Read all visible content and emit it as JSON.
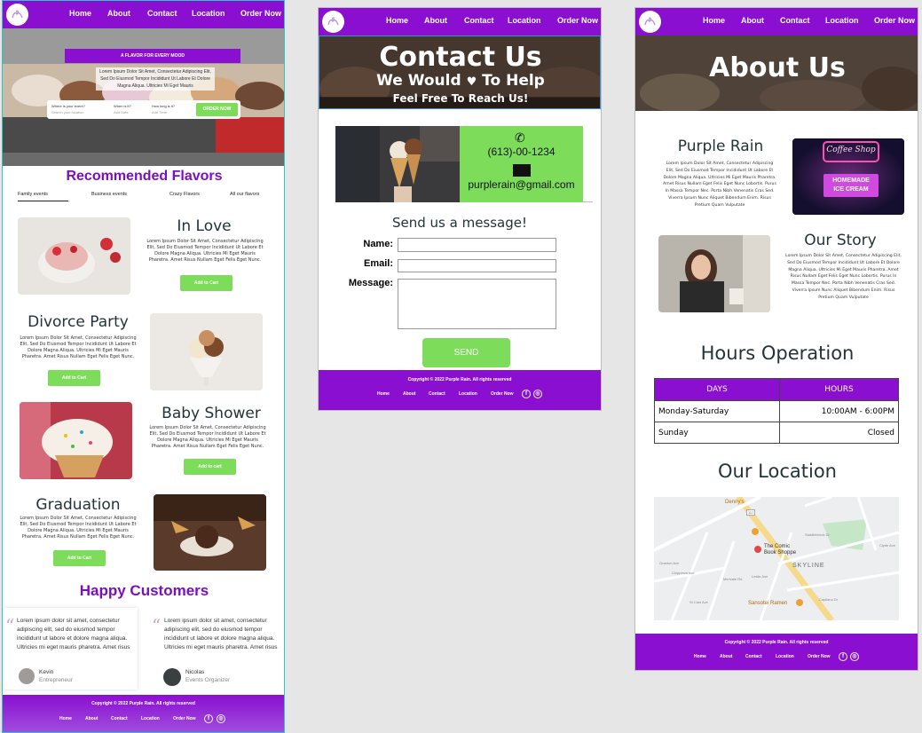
{
  "nav": {
    "home": "Home",
    "about": "About",
    "contact": "Contact",
    "location": "Location",
    "order": "Order Now"
  },
  "footer": {
    "copyright": "Copyright © 2022 Purple Rain. All rights reserved",
    "home": "Home",
    "about": "About",
    "contact": "Contact",
    "location": "Location",
    "order": "Order Now"
  },
  "lorem_short": "Lorem Ipsum Dolor Sit Amet, Consectetur Adipiscing Elit, Sed Do Eiusmod Tempor Incididunt Ut Labore Et Dolore Magna Aliqua. Ultricies Mi Eget Mauris Pharetra. Amet Risus Nullam Eget Felis Eget Nunc.",
  "home": {
    "hero": {
      "banner": "A FLAVOR FOR EVERY MOOD",
      "text": "Lorem Ipsum Dolor Sit Amet, Consectetur Adipiscing Elit, Sed Do Eiusmod Tempor Incididunt Ut Labore Et Dolore Magna Aliqua. Ultricies Mi Eget Mauris",
      "where_label": "Where is your event?",
      "where_placeholder": "Search your location",
      "when_label": "When is it?",
      "when_placeholder": "Add Date",
      "long_label": "How long is it?",
      "long_placeholder": "Add Time",
      "order_btn": "ORDER NOW"
    },
    "recommended_title": "Recommended Flavors",
    "tabs": [
      "Family events",
      "Business events",
      "Crazy Flavors",
      "All our flavors"
    ],
    "flavors": [
      {
        "title": "In Love",
        "button": "Add to Cart"
      },
      {
        "title": "Divorce Party",
        "button": "Add to Cart"
      },
      {
        "title": "Baby Shower",
        "button": "Add to cart"
      },
      {
        "title": "Graduation",
        "button": "Add to Cart"
      }
    ],
    "happy_title": "Happy Customers",
    "testimonial_text": "Lorem ipsum dolor sit amet, consectetur adipiscing elit, sed do eiusmod tempor incididunt ut labore et dolore magna aliqua. Ultricies mi eget mauris pharetra. Amet risus",
    "testimonials": [
      {
        "name": "Kevin",
        "role": "Entrepreneur"
      },
      {
        "name": "Nicolas",
        "role": "Events Organizer"
      }
    ]
  },
  "contact": {
    "title": "Contact Us",
    "line1a": "We Would",
    "line1b": "To Help",
    "line2": "Feel Free To Reach Us!",
    "phone": "(613)-00-1234",
    "email": "purplerain@gmail.com",
    "form_title": "Send us a message!",
    "name_label": "Name:",
    "email_label": "Email:",
    "message_label": "Message:",
    "send": "SEND"
  },
  "about": {
    "title": "About Us",
    "purple_rain": "Purple Rain",
    "about_text": "Lorem Ipsum Dolor Sit Amet, Consectetur Adipiscing Elit, Sed Do Eiusmod Tempor Incididunt Ut Labore Et Dolore Magna Aliqua. Ultricies Mi Eget Mauris Pharetra. Amet Risus Nullam Eget Felis Eget Nunc Lobortis. Purus In Massa Tempor Nec. Porta Nibh Venenatis Cras Sed. Viverra Ipsum Nunc Aliquet Bibendum Enim. Risus Pretium Quam Vulputate",
    "our_story": "Our Story",
    "neon_top": "Coffee Shop",
    "neon_bottom1": "HOMEMADE",
    "neon_bottom2": "ICE CREAM",
    "hours_title": "Hours Operation",
    "days_header": "DAYS",
    "hours_header": "HOURS",
    "rows": [
      {
        "day": "Monday-Saturday",
        "hours": "10:00AM - 6:00PM"
      },
      {
        "day": "Sunday",
        "hours": "Closed"
      }
    ],
    "location_title": "Our Location",
    "map": {
      "dennys": "Denny's",
      "comic1": "The Comic",
      "comic2": "Book Shoppe",
      "skyline": "SKYLINE",
      "sansotei": "Sansotei Ramen",
      "street1": "Granton Ave",
      "street2": "Chippewa Ave",
      "street3": "St Clair Ave",
      "street4": "Merivale Rd",
      "street5": "Leslie Ave",
      "street6": "Capilano Dr",
      "street7": "Saddlebrook Dr",
      "street8": "Clyde Ave",
      "road117": "117"
    }
  },
  "colors": {
    "purple": "#8a0fd0",
    "green": "#7ddc5a",
    "title_purple": "#7a0fc0"
  }
}
